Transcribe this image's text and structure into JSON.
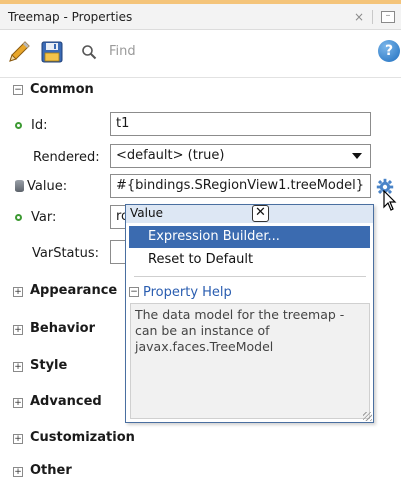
{
  "window": {
    "title": "Treemap - Properties",
    "close_glyph": "×",
    "minimize_glyph": "–"
  },
  "toolbar": {
    "search_placeholder": "Find",
    "help_glyph": "?"
  },
  "sections": {
    "common": "Common",
    "appearance": "Appearance",
    "behavior": "Behavior",
    "style": "Style",
    "advanced": "Advanced",
    "customization": "Customization",
    "other": "Other",
    "expanded_glyph": "−",
    "collapsed_glyph": "+"
  },
  "fields": {
    "id": {
      "label": "Id:",
      "value": "t1"
    },
    "rendered": {
      "label": "Rendered:",
      "value": "<default> (true)"
    },
    "value": {
      "label": "Value:",
      "value": "#{bindings.SRegionView1.treeModel}"
    },
    "var": {
      "label": "Var:",
      "value": "ro"
    },
    "var_status": {
      "label": "VarStatus:",
      "value": ""
    }
  },
  "popup": {
    "title": "Value",
    "close_glyph": "✕",
    "menu": [
      "Expression Builder...",
      "Reset to Default"
    ],
    "help_title": "Property Help",
    "help_text": "The data model for the treemap - can be an instance of javax.faces.TreeModel"
  },
  "colors": {
    "accent": "#f4c47a",
    "menu_highlight": "#3b6bb0",
    "link_blue": "#2a5db0",
    "required_green": "#3d9a33"
  },
  "icons": [
    "pencil-icon",
    "save-icon",
    "search-icon",
    "help-icon",
    "gear-icon",
    "database-icon",
    "required-dot-icon",
    "cursor-icon"
  ]
}
